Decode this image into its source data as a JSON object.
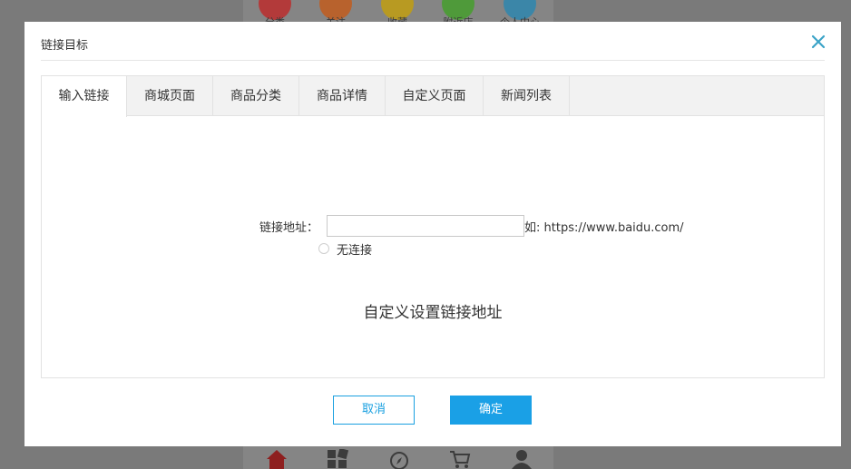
{
  "background_app": {
    "top_labels": [
      "分类",
      "关注",
      "收藏",
      "附近店",
      "个人中心"
    ],
    "top_colors": [
      "#b33a3a",
      "#b8622d",
      "#b89a22",
      "#4f9a3a",
      "#3b86a8"
    ],
    "bottom_icons": [
      "home-icon",
      "apps-icon",
      "compass-icon",
      "cart-icon",
      "user-icon"
    ]
  },
  "modal": {
    "title": "链接目标",
    "close_icon": "close-icon",
    "accent": "#1aa0e6",
    "tabs": [
      "输入链接",
      "商城页面",
      "商品分类",
      "商品详情",
      "自定义页面",
      "新闻列表"
    ],
    "active_tab": 0,
    "form": {
      "label": "链接地址：",
      "input_value": "",
      "hint": "如: https://www.baidu.com/",
      "radio_label": "无连接"
    },
    "description": "自定义设置链接地址",
    "buttons": {
      "cancel": "取消",
      "ok": "确定"
    }
  }
}
